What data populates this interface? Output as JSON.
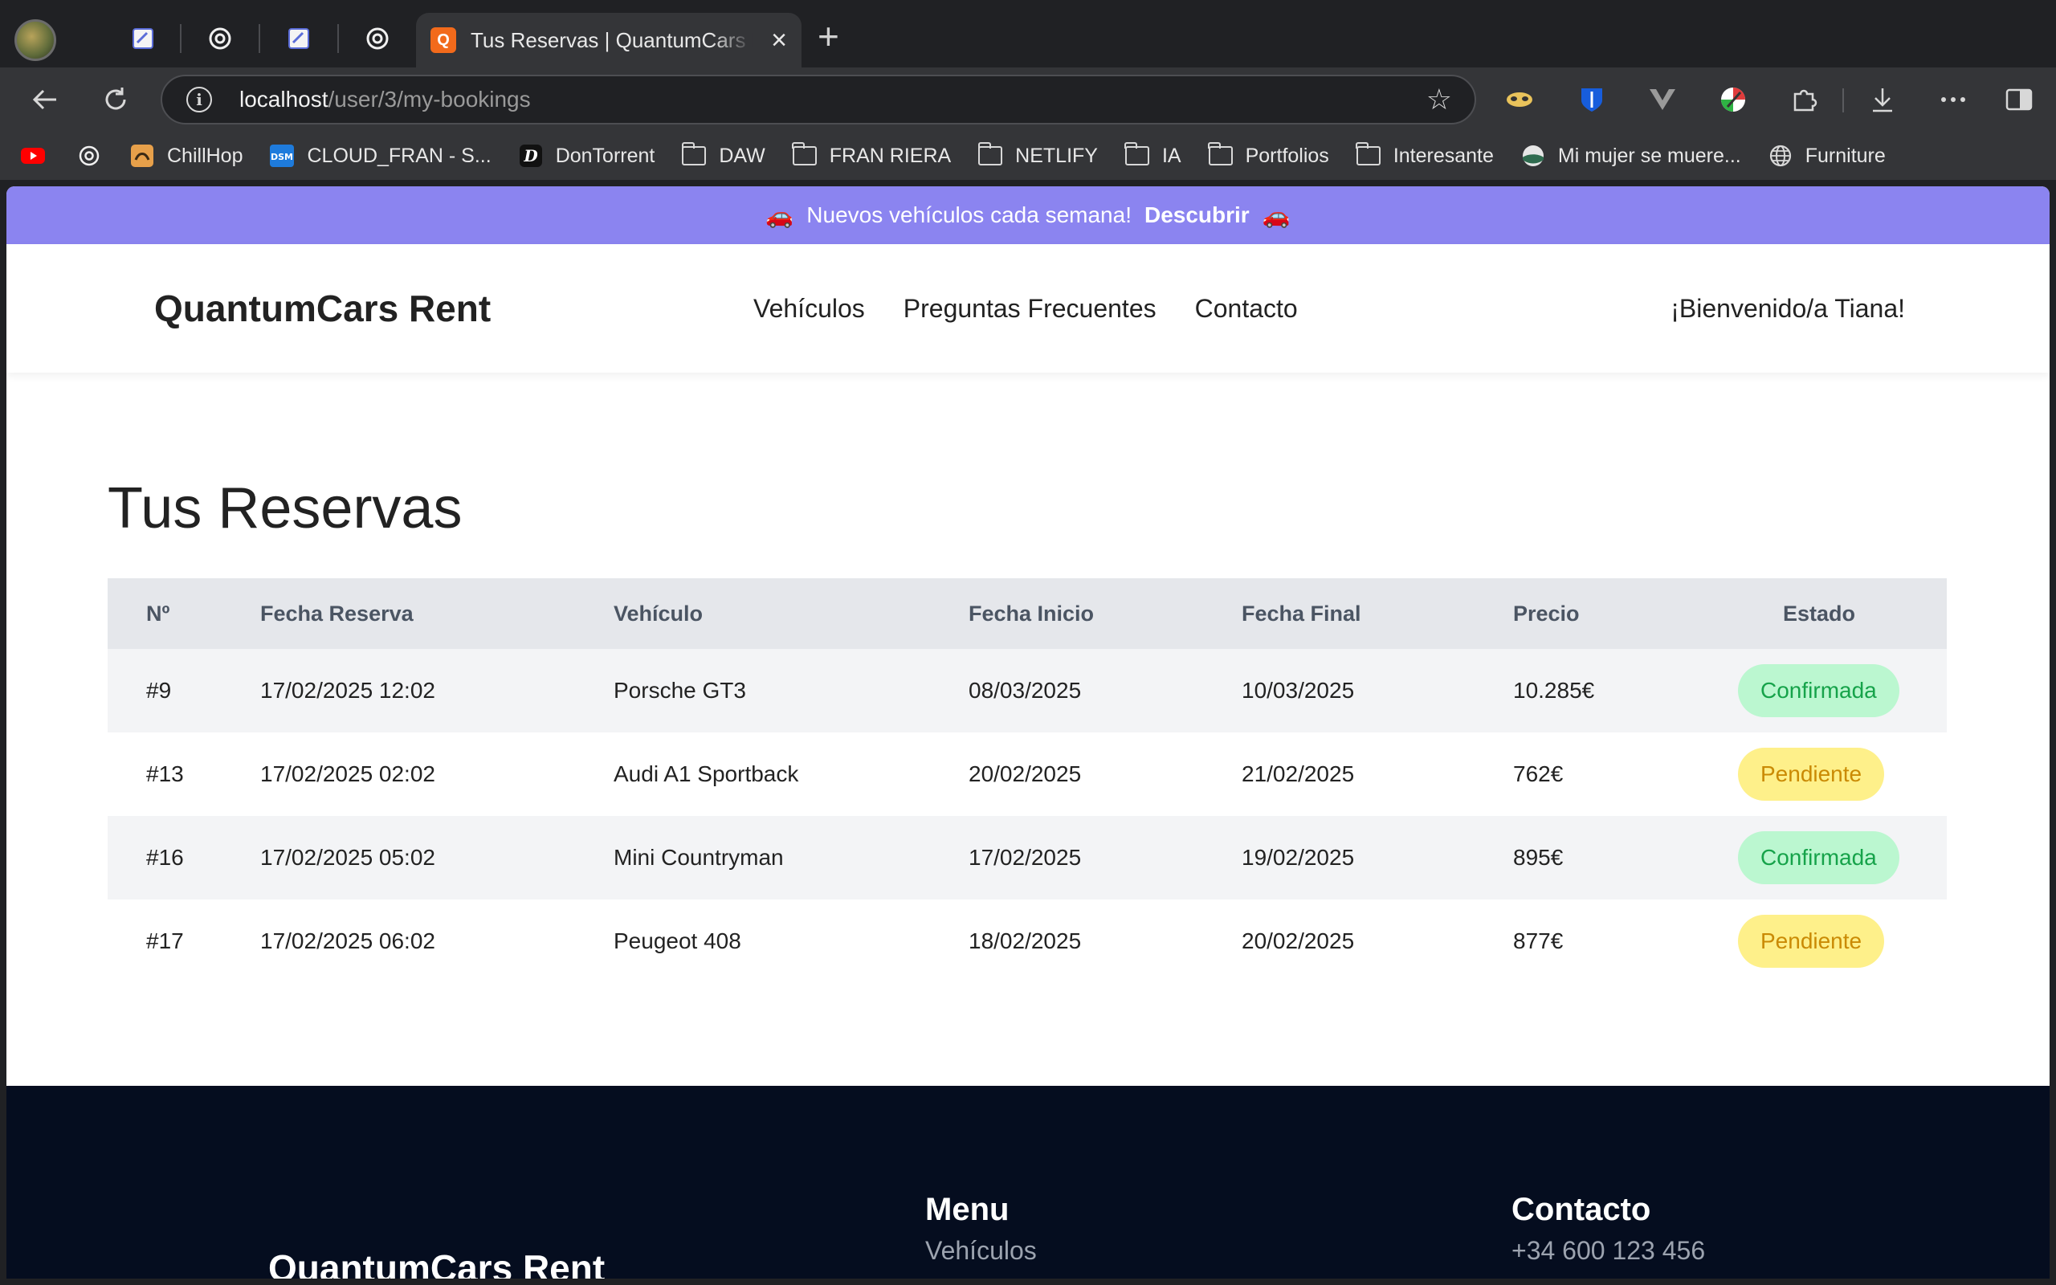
{
  "browser": {
    "active_tab_title": "Tus Reservas | QuantumCars Rent",
    "active_tab_favicon": "Q",
    "url_host": "localhost",
    "url_path": "/user/3/my-bookings",
    "bookmarks": [
      {
        "label": "",
        "icon": "youtube-icon"
      },
      {
        "label": "",
        "icon": "chatgpt-icon"
      },
      {
        "label": "ChillHop",
        "icon": "chillhop-icon"
      },
      {
        "label": "CLOUD_FRAN - S...",
        "icon": "dsm-icon"
      },
      {
        "label": "DonTorrent",
        "icon": "dontorrent-icon"
      },
      {
        "label": "DAW",
        "icon": "folder-icon"
      },
      {
        "label": "FRAN RIERA",
        "icon": "folder-icon"
      },
      {
        "label": "NETLIFY",
        "icon": "folder-icon"
      },
      {
        "label": "IA",
        "icon": "folder-icon"
      },
      {
        "label": "Portfolios",
        "icon": "folder-icon"
      },
      {
        "label": "Interesante",
        "icon": "folder-icon"
      },
      {
        "label": "Mi mujer se muere...",
        "icon": "site-icon"
      },
      {
        "label": "Furniture",
        "icon": "globe-icon"
      }
    ]
  },
  "promo": {
    "text": "Nuevos vehículos cada semana!",
    "cta": "Descubrir"
  },
  "nav": {
    "brand": "QuantumCars Rent",
    "links": [
      "Vehículos",
      "Preguntas Frecuentes",
      "Contacto"
    ],
    "welcome": "¡Bienvenido/a Tiana!"
  },
  "page": {
    "title": "Tus Reservas"
  },
  "table": {
    "headers": [
      "Nº",
      "Fecha Reserva",
      "Vehículo",
      "Fecha Inicio",
      "Fecha Final",
      "Precio",
      "Estado"
    ],
    "rows": [
      {
        "id": "#9",
        "booked": "17/02/2025 12:02",
        "vehicle": "Porsche GT3",
        "start": "08/03/2025",
        "end": "10/03/2025",
        "price": "10.285€",
        "status": "Confirmada"
      },
      {
        "id": "#13",
        "booked": "17/02/2025 02:02",
        "vehicle": "Audi A1 Sportback",
        "start": "20/02/2025",
        "end": "21/02/2025",
        "price": "762€",
        "status": "Pendiente"
      },
      {
        "id": "#16",
        "booked": "17/02/2025 05:02",
        "vehicle": "Mini Countryman",
        "start": "17/02/2025",
        "end": "19/02/2025",
        "price": "895€",
        "status": "Confirmada"
      },
      {
        "id": "#17",
        "booked": "17/02/2025 06:02",
        "vehicle": "Peugeot 408",
        "start": "18/02/2025",
        "end": "20/02/2025",
        "price": "877€",
        "status": "Pendiente"
      }
    ]
  },
  "footer": {
    "brand": "QuantumCars Rent",
    "menu_title": "Menu",
    "menu_first": "Vehículos",
    "contact_title": "Contacto",
    "contact_phone": "+34 600 123 456"
  },
  "colors": {
    "promo_bg": "#8b84f0",
    "confirmed_bg": "#bbf7d0",
    "confirmed_text": "#16a34a",
    "pending_bg": "#fef08a",
    "pending_text": "#ca8a04",
    "footer_bg": "#050d1f"
  }
}
